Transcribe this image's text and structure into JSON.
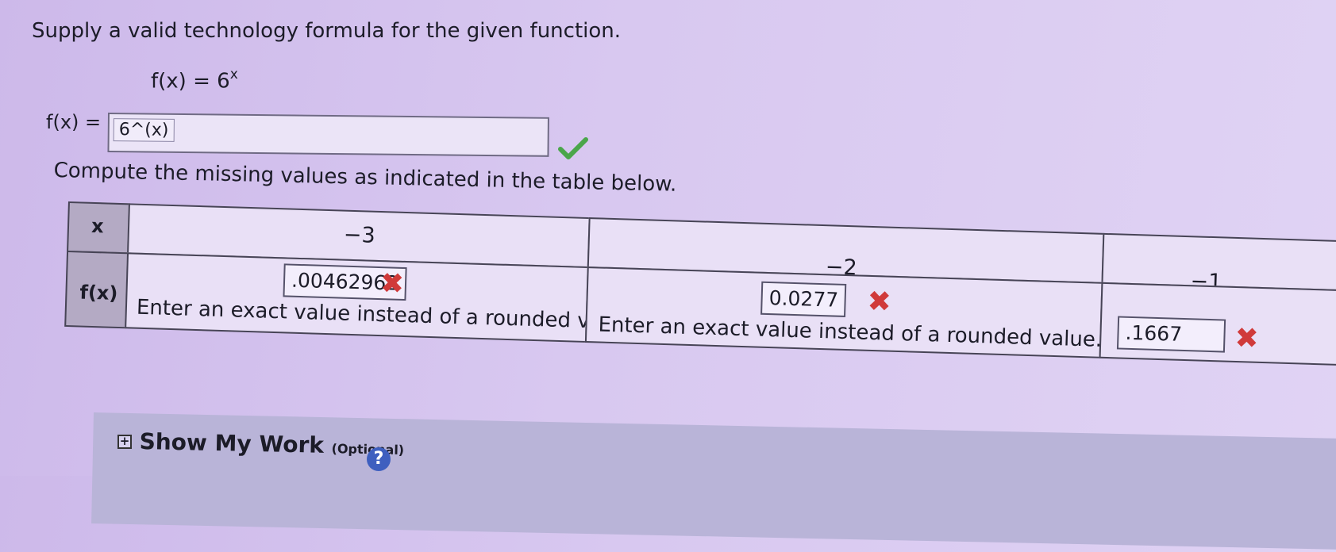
{
  "question": {
    "instruction": "Supply a valid technology formula for the given function.",
    "given_function": {
      "lhs": "f(x) = 6",
      "exponent": "x"
    },
    "formula_label": "f(x) =",
    "formula_value": "6^(x)",
    "formula_status": "correct"
  },
  "table_instruction": "Compute the missing values as indicated in the table below.",
  "table": {
    "row_x_label": "x",
    "row_f_label": "f(x)",
    "columns": [
      {
        "x": "−3",
        "answer": ".00462962",
        "status": "incorrect",
        "feedback": "Enter an exact value instead of a rounded value."
      },
      {
        "x": "−2",
        "answer": "0.0277",
        "status": "incorrect",
        "feedback": "Enter an exact value instead of a rounded value."
      },
      {
        "x": "−1",
        "answer": ".1667",
        "status": "incorrect",
        "feedback": ""
      }
    ]
  },
  "show_work": {
    "label": "Show My Work",
    "optional": "(Optional)",
    "help": "?"
  },
  "icons": {
    "correct": "check-icon",
    "incorrect": "x-icon",
    "expand": "plus-icon",
    "help": "help-icon"
  },
  "colors": {
    "correct": "#4aa64a",
    "incorrect": "#d03a3a",
    "help": "#3e5fbf"
  }
}
